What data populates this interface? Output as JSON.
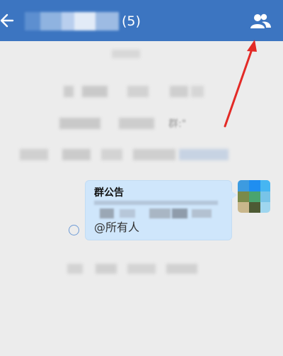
{
  "header": {
    "member_count": "(5)"
  },
  "announcement": {
    "title": "群公告",
    "mention": "@所有人"
  },
  "messages": [
    {
      "visible_fragment": "群:\""
    }
  ],
  "colors": {
    "header_bg": "#3c75c1",
    "bubble_bg": "#cfe6fb",
    "page_bg": "#ececec",
    "arrow": "#e32a26"
  }
}
